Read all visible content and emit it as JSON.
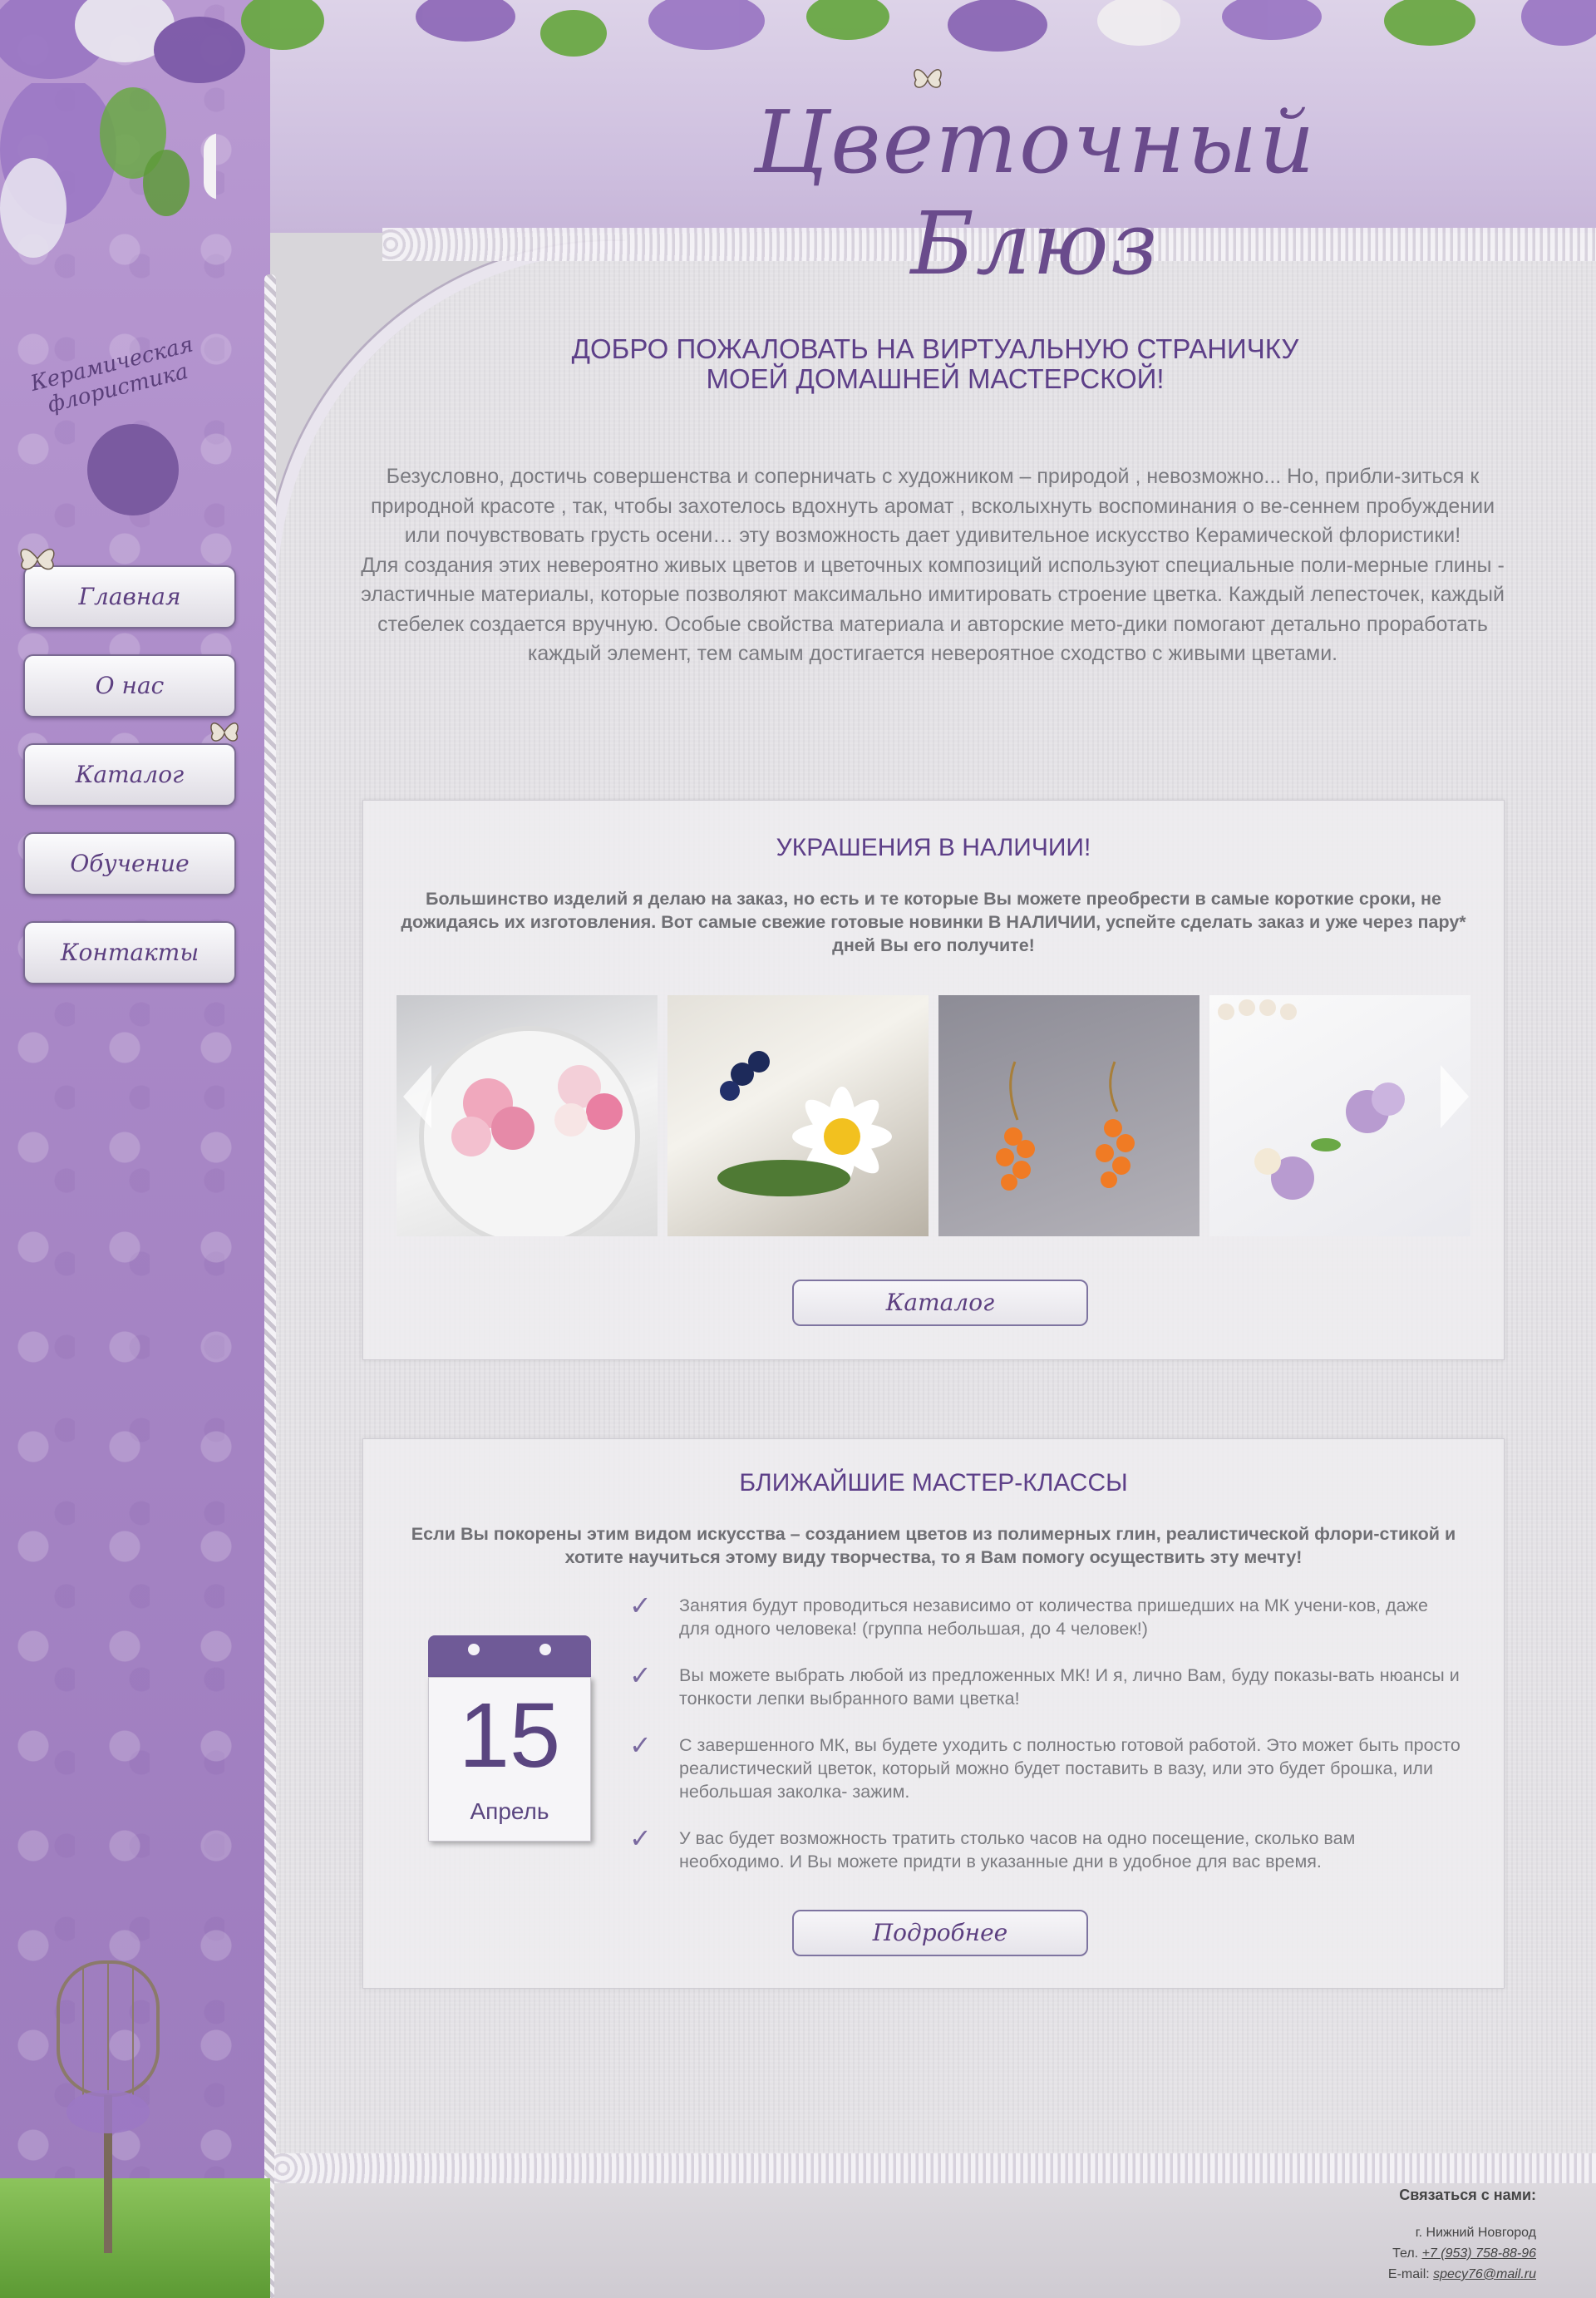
{
  "site": {
    "title": "Цветочный Блюз",
    "logo_text": "Керамическая флористика"
  },
  "nav": {
    "items": [
      {
        "label": "Главная"
      },
      {
        "label": "О нас"
      },
      {
        "label": "Каталог"
      },
      {
        "label": "Обучение"
      },
      {
        "label": "Контакты"
      }
    ]
  },
  "intro": {
    "heading_line1": "ДОБРО ПОЖАЛОВАТЬ НА ВИРТУАЛЬНУЮ СТРАНИЧКУ",
    "heading_line2": "МОЕЙ ДОМАШНЕЙ МАСТЕРСКОЙ!",
    "paragraph1": "Безусловно, достичь совершенства и соперничать с художником – природой , невозможно... Но, прибли-зиться к природной красоте , так, чтобы захотелось вдохнуть аромат , всколыхнуть воспоминания о ве-сеннем пробуждении или почувствовать грусть осени… эту возможность дает удивительное искусство Керамической флористики!",
    "paragraph2": "Для создания этих невероятно живых цветов и цветочных композиций используют специальные поли-мерные глины - эластичные материалы, которые позволяют максимально имитировать строение цветка. Каждый лепесточек, каждый стебелек создается вручную. Особые свойства материала и авторские мето-дики помогают детально проработать каждый элемент, тем самым достигается невероятное сходство с живыми цветами."
  },
  "jewelry": {
    "heading": "УКРАШЕНИЯ В НАЛИЧИИ!",
    "text": "Большинство изделий я делаю на заказ, но есть и те которые Вы можете преобрести в самые короткие сроки, не дожидаясь их изготовления. Вот самые свежие готовые новинки В НАЛИЧИИ, успейте сделать заказ и уже через пару* дней Вы его получите!",
    "photos": [
      {
        "name": "pink-roses-earrings"
      },
      {
        "name": "daisy-berry-brooch"
      },
      {
        "name": "orange-berry-earrings"
      },
      {
        "name": "lilac-flower-earrings"
      }
    ],
    "button_label": "Каталог"
  },
  "classes": {
    "heading": "БЛИЖАЙШИЕ МАСТЕР-КЛАССЫ",
    "text": "Если Вы покорены этим видом искусства – созданием цветов из полимерных глин, реалистической флори-стикой и хотите научиться этому виду творчества, то я  Вам помогу осуществить эту мечту!",
    "calendar": {
      "day": "15",
      "month": "Апрель"
    },
    "bullets": [
      "Занятия будут проводиться независимо от количества пришедших на МК учени-ков, даже для одного человека! (группа небольшая, до 4 человек!)",
      "Вы можете выбрать любой из предложенных  МК! И я, лично Вам, буду показы-вать нюансы и тонкости лепки выбранного вами цветка!",
      "С завершенного МК, вы будете уходить с полностью готовой работой. Это может быть просто реалистический цветок, который можно будет поставить в вазу, или это будет брошка, или небольшая заколка- зажим.",
      "У вас будет возможность тратить столько часов на одно посещение, сколько вам необходимо. И Вы можете придти в указанные дни в удобное для вас время."
    ],
    "button_label": "Подробнее"
  },
  "footer": {
    "title": "Связаться с нами:",
    "city": "г. Нижний Новгород",
    "phone_label": "Тел.",
    "phone": "+7 (953) 758-88-96",
    "email_label": "E-mail:",
    "email": "specy76@mail.ru"
  },
  "colors": {
    "accent": "#5d3f88",
    "side": "#a887c6",
    "text": "#7a7a80"
  }
}
